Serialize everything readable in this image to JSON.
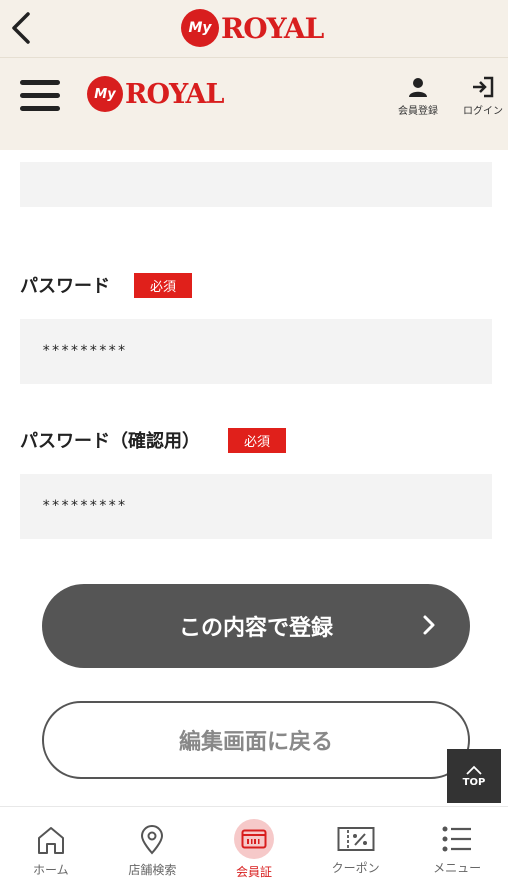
{
  "topbar": {
    "logo_my": "My",
    "logo_word": "ROYAL"
  },
  "header": {
    "logo_my": "My",
    "logo_word": "ROYAL",
    "register_label": "会員登録",
    "login_label": "ログイン"
  },
  "form": {
    "password": {
      "label": "パスワード",
      "required": "必須",
      "value": "*********"
    },
    "password_confirm": {
      "label": "パスワード（確認用）",
      "required": "必須",
      "value": "*********"
    }
  },
  "buttons": {
    "submit_label": "この内容で登録",
    "back_label": "編集画面に戻る",
    "top_label": "TOP"
  },
  "bottom_nav": {
    "items": [
      {
        "label": "ホーム",
        "icon": "home-icon"
      },
      {
        "label": "店舗検索",
        "icon": "map-pin-icon"
      },
      {
        "label": "会員証",
        "icon": "member-card-icon",
        "active": true
      },
      {
        "label": "クーポン",
        "icon": "coupon-icon"
      },
      {
        "label": "メニュー",
        "icon": "list-menu-icon"
      }
    ]
  },
  "colors": {
    "brand_red": "#d81e1e",
    "header_bg": "#f5f0e8",
    "button_dark": "#555555"
  }
}
